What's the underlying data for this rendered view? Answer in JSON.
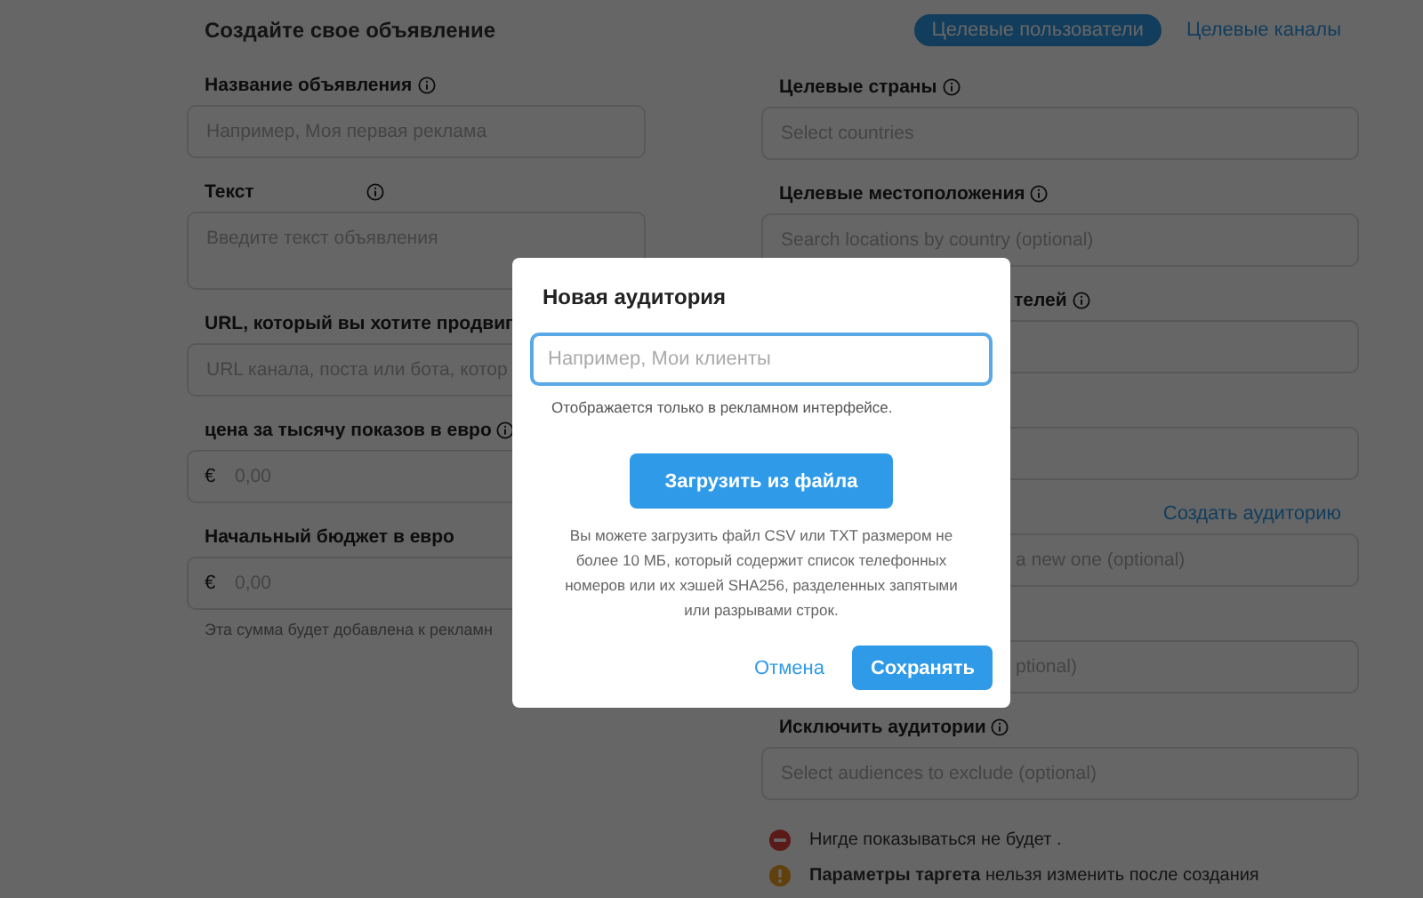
{
  "page_title": "Создайте свое объявление",
  "tabs": [
    {
      "label": "Целевые пользователи",
      "selected": true
    },
    {
      "label": "Целевые каналы",
      "selected": false
    }
  ],
  "left_fields": [
    {
      "label": "Название объявления",
      "info": true,
      "kind": "input",
      "placeholder": "Например, Моя первая реклама"
    },
    {
      "label": "Текст",
      "info": true,
      "kind": "textarea",
      "placeholder": "Введите текст объявления"
    },
    {
      "label": "URL, который вы хотите продвиг",
      "kind": "input",
      "placeholder": "URL канала, поста или бота, котор"
    },
    {
      "label": "цена за тысячу показов в евро",
      "info": true,
      "kind": "money",
      "prefix": "€",
      "placeholder": "0,00"
    },
    {
      "label": "Начальный бюджет в евро",
      "kind": "money",
      "prefix": "€",
      "placeholder": "0,00",
      "note": "Эта сумма будет добавлена к рекламн"
    }
  ],
  "right_fields": [
    {
      "label": "Целевые страны",
      "info": true,
      "kind": "input",
      "placeholder": "Select countries"
    },
    {
      "label": "Целевые местоположения",
      "info": true,
      "kind": "input",
      "placeholder": "Search locations by country (optional)"
    },
    {
      "label": "телей",
      "info": true,
      "kind": "input",
      "covered": true
    },
    {
      "kind": "input"
    },
    {
      "kind": "input",
      "link": "Создать аудиторию",
      "placeholder": "a new one (optional)",
      "covered": true
    },
    {
      "kind": "input",
      "placeholder": "ptional)",
      "covered": true
    },
    {
      "label": "Исключить аудитории",
      "info": true,
      "kind": "input",
      "placeholder": "Select audiences to exclude (optional)"
    }
  ],
  "notices": [
    {
      "kind": "error",
      "text": "Нигде показываться не будет ."
    },
    {
      "kind": "warning",
      "text": "**Параметры таргета** нельзя изменить после создания"
    }
  ],
  "dialog": {
    "title": "Новая аудитория",
    "placeholder": "Например, Мои клиенты",
    "hint": "Отображается только в рекламном интерфейсе.",
    "upload_button": "Загрузить из файла",
    "description": "Вы можете загрузить файл CSV или TXT размером не более 10 МБ, который содержит список телефонных номеров или их хэшей SHA256, разделенных запятыми или разрывами строк.",
    "cancel": "Отмена",
    "save": "Сохранять"
  }
}
